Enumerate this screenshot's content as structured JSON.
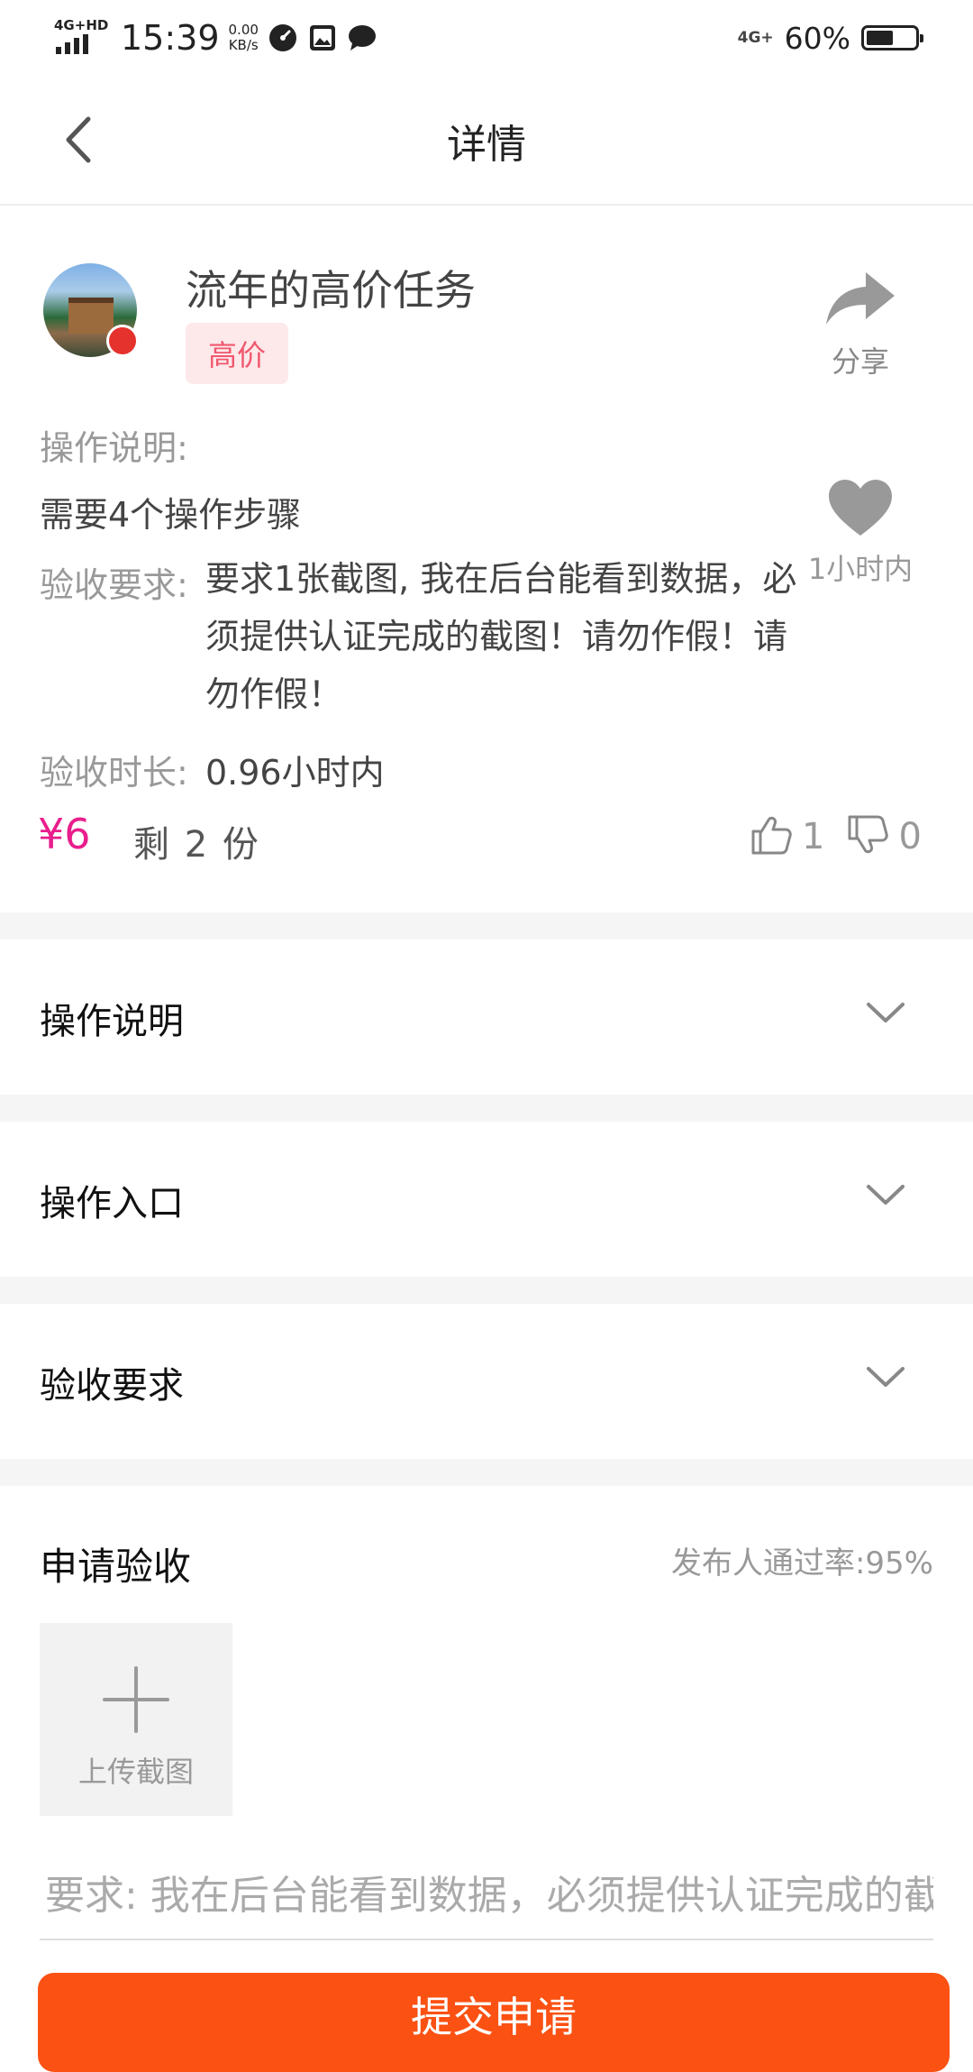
{
  "status_bar": {
    "network_label": "4G+HD",
    "time": "15:39",
    "speed_value": "0.00",
    "speed_unit": "KB/s",
    "signal_label": "4G+",
    "battery_percent": "60%",
    "battery_level": 0.6
  },
  "nav": {
    "title": "详情"
  },
  "task": {
    "title": "流年的高价任务",
    "tag": "高价",
    "share_label": "分享",
    "operation_heading": "操作说明:",
    "operation_steps": "需要4个操作步骤",
    "requirement_label": "验收要求:",
    "requirement_text": "要求1张截图, 我在后台能看到数据，必须提供认证完成的截图！请勿作假！请勿作假！",
    "favorite_label": "1小时内",
    "duration_label": "验收时长:",
    "duration_value": "0.96小时内",
    "price": "¥6",
    "remaining": "剩 2 份",
    "likes": "1",
    "dislikes": "0"
  },
  "sections": [
    {
      "label": "操作说明"
    },
    {
      "label": "操作入口"
    },
    {
      "label": "验收要求"
    }
  ],
  "apply": {
    "title": "申请验收",
    "pass_rate": "发布人通过率:95%",
    "upload_label": "上传截图",
    "input_placeholder": "要求: 我在后台能看到数据，必须提供认证完成的截图！请勿作假！请勿作假！",
    "submit_label": "提交申请"
  }
}
